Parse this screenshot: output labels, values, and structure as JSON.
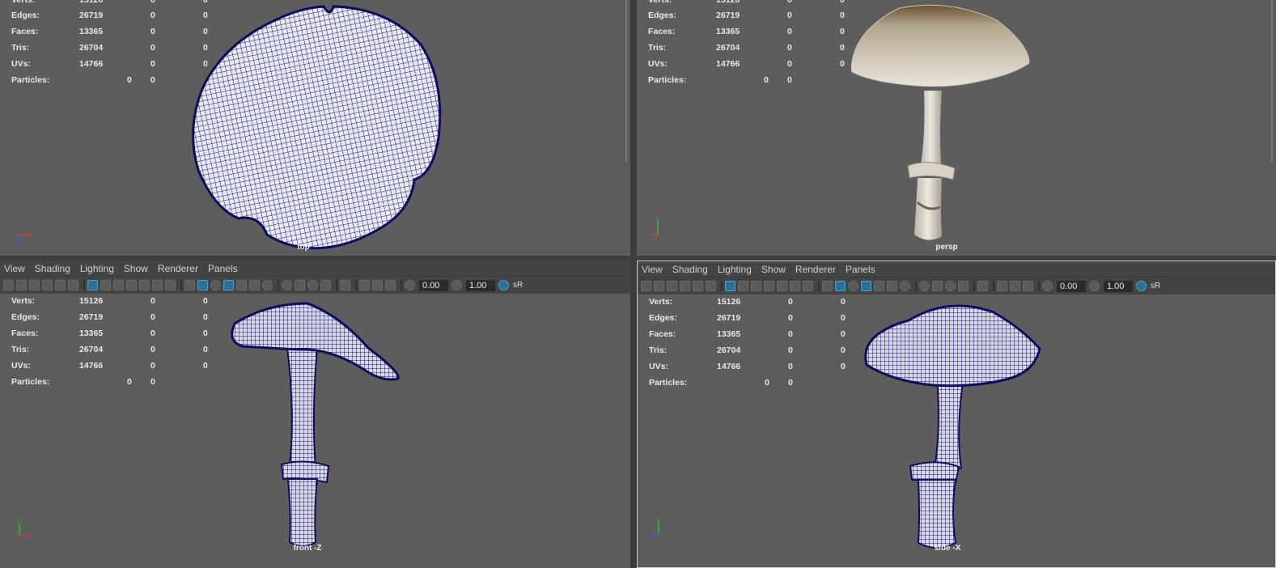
{
  "menu": [
    "View",
    "Shading",
    "Lighting",
    "Show",
    "Renderer",
    "Panels"
  ],
  "toolbar": {
    "value_a": "0.00",
    "value_b": "1.00",
    "color_space": "sR"
  },
  "hud_labels": [
    "Verts:",
    "Edges:",
    "Faces:",
    "Tris:",
    "UVs:",
    "Particles:"
  ],
  "hud_values": {
    "verts": [
      "15126",
      "0",
      "0"
    ],
    "edges": [
      "26719",
      "0",
      "0"
    ],
    "faces": [
      "13365",
      "0",
      "0"
    ],
    "tris": [
      "26704",
      "0",
      "0"
    ],
    "uvs": [
      "14766",
      "0",
      "0"
    ],
    "particles": [
      "0",
      "0"
    ]
  },
  "top_partial_verts": "15126",
  "viewports": {
    "top": "top",
    "persp": "persp",
    "front": "front -Z",
    "side": "side -X"
  },
  "colors": {
    "viewport_bg": "#5d5d5d",
    "wire": "#16176e",
    "ui_bar": "#444444",
    "accent": "#2f6f91"
  },
  "icons": [
    "camera-icon",
    "camera-attr-icon",
    "bookmark-icon",
    "grid-icon",
    "wireframe-icon",
    "smooth-shade-icon",
    "textured-icon",
    "lights-icon",
    "xray-icon",
    "isolate-icon",
    "exposure-icon",
    "gamma-icon",
    "color-mgmt-icon"
  ]
}
